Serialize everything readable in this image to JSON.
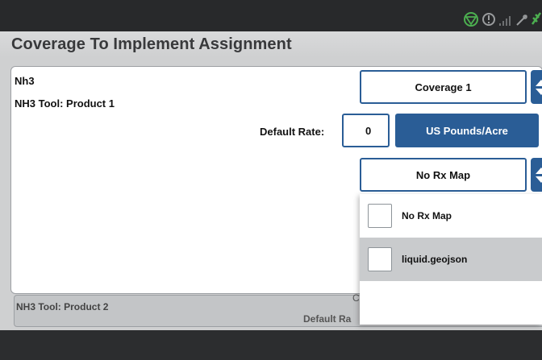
{
  "title": "Coverage To Implement Assignment",
  "product1": {
    "product_name": "Nh3",
    "tool_label": "NH3 Tool: Product 1",
    "coverage_select": "Coverage 1",
    "default_rate_label": "Default Rate:",
    "default_rate_value": "0",
    "units_label": "US Pounds/Acre",
    "rx_map_select": "No Rx Map"
  },
  "product2": {
    "tool_label": "NH3 Tool: Product 2",
    "default_rate_label": "Default Ra",
    "coverage_fragment": "C"
  },
  "rx_dropdown": {
    "options": [
      {
        "label": "No Rx Map",
        "checked": false
      },
      {
        "label": "liquid.geojson",
        "checked": false
      }
    ]
  },
  "status_icons": [
    "gps-icon",
    "alert-icon",
    "signal-icon",
    "modem-icon",
    "satellite-icon"
  ],
  "colors": {
    "accent": "#2a5d96",
    "title_bg": "#d9dadb",
    "status_ok": "#4caf50"
  }
}
